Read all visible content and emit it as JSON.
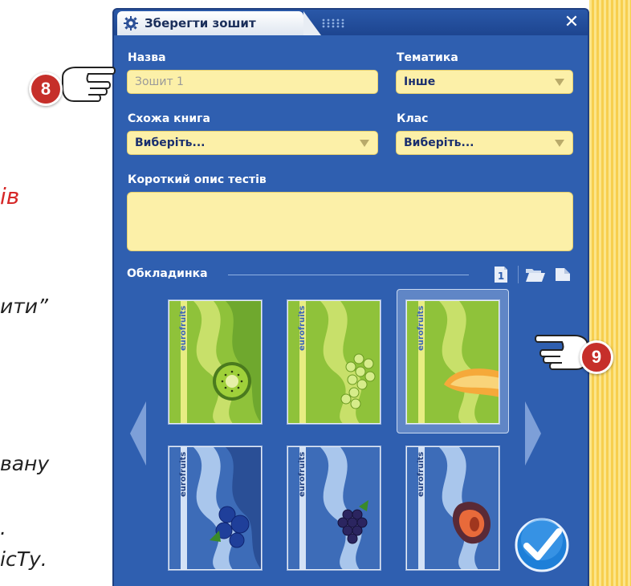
{
  "left_page": {
    "fragments": [
      {
        "text": "ів",
        "red": true
      },
      {
        "text": "ити”",
        "red": false
      },
      {
        "text": "вану",
        "red": false
      },
      {
        "text": ".",
        "red": false
      },
      {
        "text": "ісТу.",
        "red": false
      }
    ]
  },
  "callouts": [
    "8",
    "9"
  ],
  "dialog": {
    "title": "Зберегти зошит",
    "close_glyph": "✕",
    "name_label": "Назва",
    "name_placeholder": "Зошит 1",
    "topic_label": "Тематика",
    "topic_value": "Інше",
    "book_label": "Схожа книга",
    "book_value": "Виберіть...",
    "class_label": "Клас",
    "class_value": "Виберіть...",
    "desc_label": "Короткий опис тестів",
    "cover_label": "Обкладинка",
    "cover_page_number": "1",
    "brand_text": "eurofruits",
    "covers": [
      {
        "theme": "green",
        "fruit": "kiwi",
        "selected": false
      },
      {
        "theme": "green",
        "fruit": "grapes",
        "selected": false
      },
      {
        "theme": "green",
        "fruit": "melon",
        "selected": true
      },
      {
        "theme": "blue",
        "fruit": "blueberries",
        "selected": false
      },
      {
        "theme": "blue",
        "fruit": "blackberries",
        "selected": false
      },
      {
        "theme": "blue",
        "fruit": "plum",
        "selected": false
      }
    ]
  },
  "colors": {
    "dialog_bg": "#2f5fb0",
    "field_bg": "#fcf0a8",
    "callout": "#c62f2a",
    "accent_red_text": "#d62828"
  }
}
